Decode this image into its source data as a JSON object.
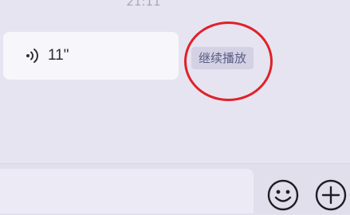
{
  "chat": {
    "timestamp": "21:11",
    "voice_message": {
      "icon": "voice-wave-icon",
      "duration": "11\""
    },
    "resume_label": "继续播放"
  },
  "input_bar": {
    "emoji_icon": "smiley-icon",
    "plus_icon": "plus-circle-icon"
  },
  "colors": {
    "highlight": "#e02128",
    "background": "#e6e4f1"
  }
}
